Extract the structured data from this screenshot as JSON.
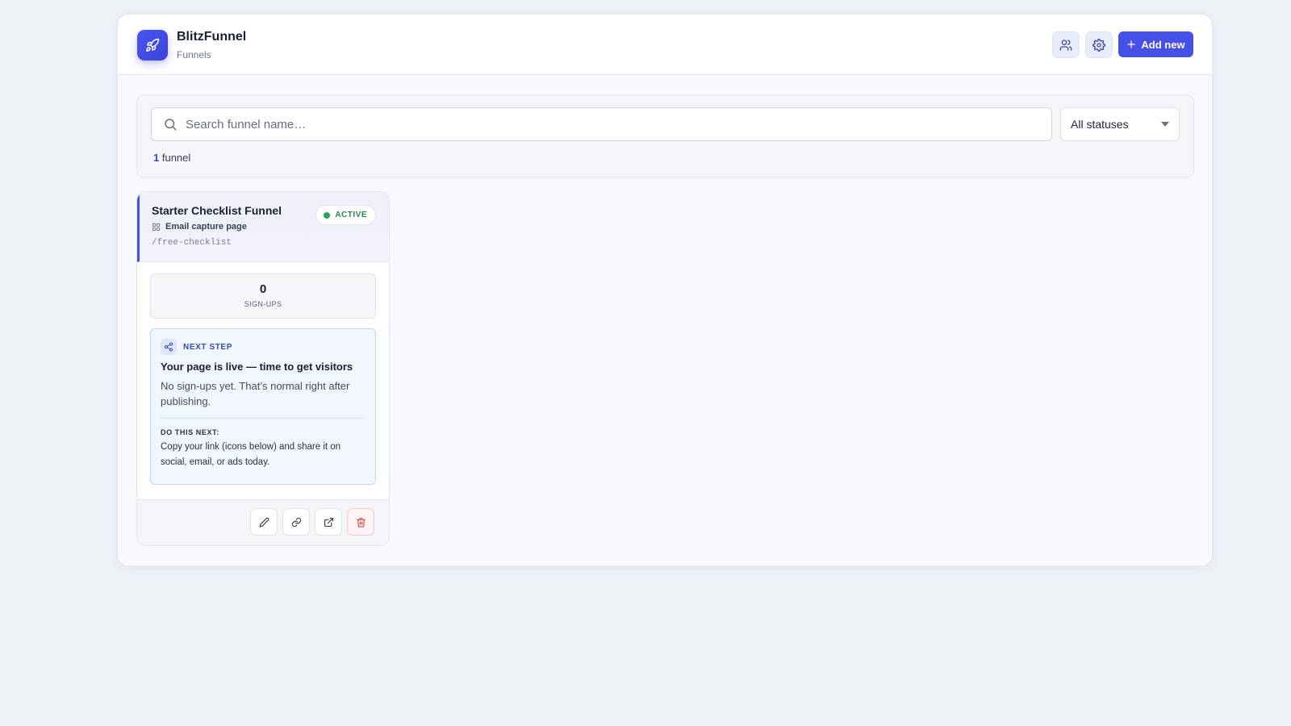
{
  "header": {
    "brand_name": "BlitzFunnel",
    "brand_sub": "Funnels",
    "logo_icon": "rocket-icon",
    "add_label": "Add new",
    "accent": "#4450e6"
  },
  "filters": {
    "search_placeholder": "Search funnel name…",
    "search_value": "",
    "status_selected": "All statuses",
    "count_number": "1",
    "count_label": " funnel"
  },
  "funnels": [
    {
      "title": "Starter Checklist Funnel",
      "type": "Email capture page",
      "slug": "/free-checklist",
      "status": "ACTIVE",
      "status_color": "#22a55a",
      "signups_value": "0",
      "signups_label": "SIGN-UPS",
      "next_step": {
        "label": "NEXT STEP",
        "title": "Your page is live — time to get visitors",
        "description": "No sign-ups yet. That’s normal right after publishing.",
        "action_label": "DO THIS NEXT:",
        "action_text": "Copy your link (icons below) and share it on social, email, or ads today."
      },
      "actions": [
        "edit-icon",
        "link-icon",
        "external-link-icon",
        "trash-icon"
      ]
    }
  ]
}
